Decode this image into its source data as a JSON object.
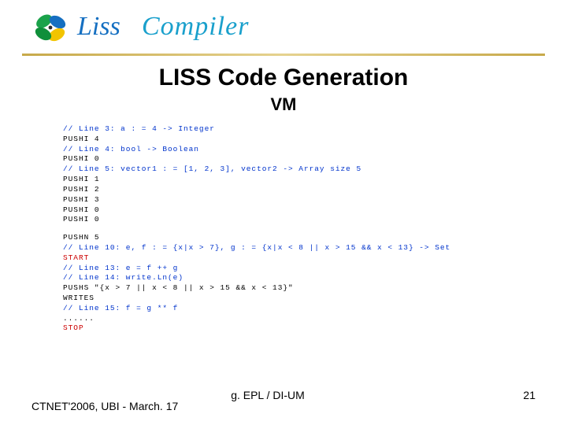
{
  "header": {
    "logo_text_word1": "Liss",
    "logo_text_word2": "Compiler"
  },
  "title": "LISS Code Generation",
  "subtitle": "VM",
  "code": {
    "block1_lines": [
      {
        "text": "// Line 3: a : = 4 -> Integer",
        "class": "blue"
      },
      {
        "text": "PUSHI 4",
        "class": ""
      },
      {
        "text": "// Line 4: bool -> Boolean",
        "class": "blue"
      },
      {
        "text": "PUSHI 0",
        "class": ""
      },
      {
        "text": "// Line 5: vector1 : = [1, 2, 3], vector2 -> Array size 5",
        "class": "blue"
      },
      {
        "text": "PUSHI 1",
        "class": ""
      },
      {
        "text": "PUSHI 2",
        "class": ""
      },
      {
        "text": "PUSHI 3",
        "class": ""
      },
      {
        "text": "PUSHI 0",
        "class": ""
      },
      {
        "text": "PUSHI 0",
        "class": ""
      }
    ],
    "block2_lines": [
      {
        "text": "PUSHN 5",
        "class": ""
      },
      {
        "text": "// Line 10: e, f : = {x|x > 7}, g : = {x|x < 8 || x > 15 && x < 13} -> Set",
        "class": "blue"
      },
      {
        "text": "START",
        "class": "red"
      },
      {
        "text": "// Line 13: e = f ++ g",
        "class": "blue"
      },
      {
        "text": "// Line 14: write.Ln(e)",
        "class": "blue"
      },
      {
        "text": "PUSHS \"{x > 7 || x < 8 || x > 15 && x < 13}\"",
        "class": ""
      },
      {
        "text": "WRITES",
        "class": ""
      },
      {
        "text": "// Line 15: f = g ** f",
        "class": "blue"
      },
      {
        "text": "......",
        "class": ""
      },
      {
        "text": "STOP",
        "class": "red"
      }
    ]
  },
  "footer": {
    "left": "CTNET'2006, UBI - March. 17",
    "center": "g. EPL / DI-UM",
    "right": "21"
  }
}
